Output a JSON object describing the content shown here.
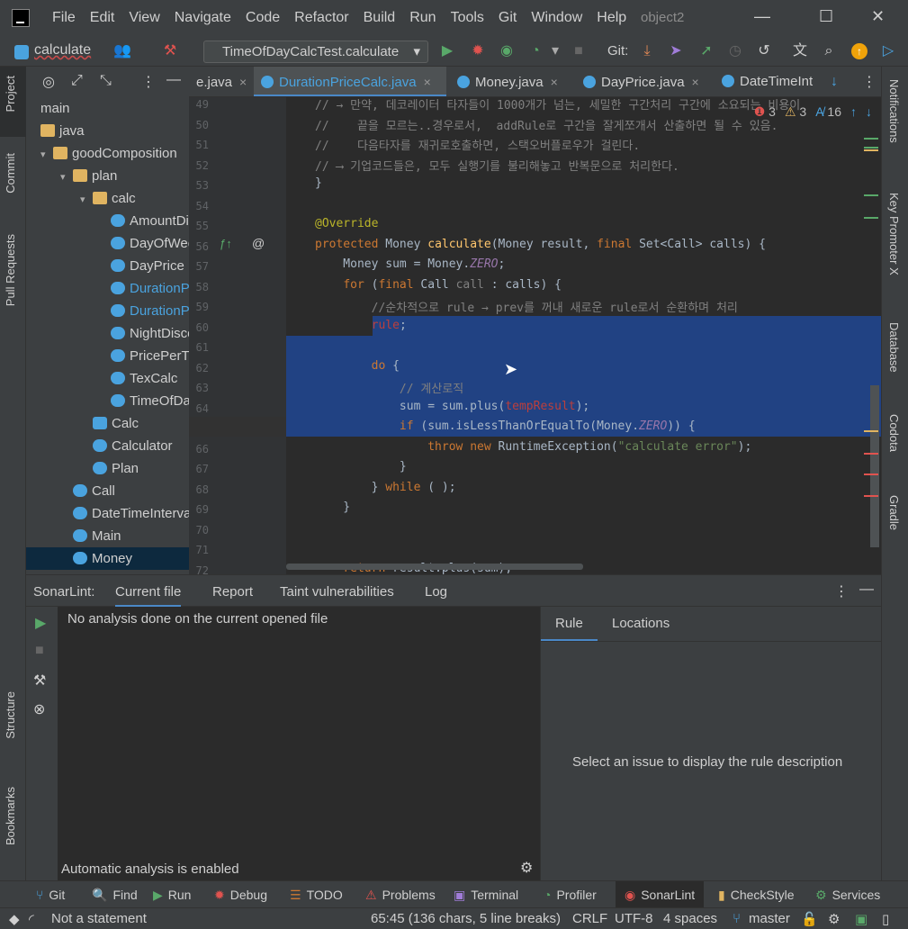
{
  "menubar": {
    "items": [
      "File",
      "Edit",
      "View",
      "Navigate",
      "Code",
      "Refactor",
      "Build",
      "Run",
      "Tools",
      "Git",
      "Window",
      "Help"
    ],
    "project_name": "object2"
  },
  "toolbar": {
    "breadcrumb": "calculate",
    "run_config": "TimeOfDayCalcTest.calculate",
    "git_label": "Git:"
  },
  "left_strip": {
    "project": "Project",
    "commit": "Commit",
    "pull_requests": "Pull Requests",
    "structure": "Structure",
    "bookmarks": "Bookmarks"
  },
  "right_strip": {
    "notifications": "Notifications",
    "key_promoter": "Key Promoter X",
    "database": "Database",
    "codota": "Codota",
    "gradle": "Gradle"
  },
  "project_tree": {
    "rows": [
      {
        "label": "main",
        "indent": 0,
        "icon": "none"
      },
      {
        "label": "java",
        "indent": 0,
        "icon": "folder"
      },
      {
        "label": "goodComposition",
        "indent": 1,
        "icon": "folder",
        "caret": "▾"
      },
      {
        "label": "plan",
        "indent": 2,
        "icon": "folder",
        "caret": "▾"
      },
      {
        "label": "calc",
        "indent": 3,
        "icon": "folder",
        "caret": "▾"
      },
      {
        "label": "AmountDis",
        "indent": 4,
        "icon": "cls"
      },
      {
        "label": "DayOfWee",
        "indent": 4,
        "icon": "cls"
      },
      {
        "label": "DayPrice",
        "indent": 4,
        "icon": "cls"
      },
      {
        "label": "DurationPri",
        "indent": 4,
        "icon": "cls",
        "modified": true
      },
      {
        "label": "DurationPri",
        "indent": 4,
        "icon": "cls",
        "modified": true
      },
      {
        "label": "NightDisco",
        "indent": 4,
        "icon": "cls"
      },
      {
        "label": "PricePerTim",
        "indent": 4,
        "icon": "cls"
      },
      {
        "label": "TexCalc",
        "indent": 4,
        "icon": "cls"
      },
      {
        "label": "TimeOfDay",
        "indent": 4,
        "icon": "cls"
      },
      {
        "label": "Calc",
        "indent": 3,
        "icon": "iface"
      },
      {
        "label": "Calculator",
        "indent": 3,
        "icon": "cls"
      },
      {
        "label": "Plan",
        "indent": 3,
        "icon": "cls"
      },
      {
        "label": "Call",
        "indent": 2,
        "icon": "cls"
      },
      {
        "label": "DateTimeInterval",
        "indent": 2,
        "icon": "cls"
      },
      {
        "label": "Main",
        "indent": 2,
        "icon": "cls"
      },
      {
        "label": "Money",
        "indent": 2,
        "icon": "cls",
        "selected": true
      }
    ]
  },
  "editor_tabs": [
    {
      "label": "e.java",
      "active": false
    },
    {
      "label": "DurationPriceCalc.java",
      "active": true
    },
    {
      "label": "Money.java",
      "active": false
    },
    {
      "label": "DayPrice.java",
      "active": false
    },
    {
      "label": "DateTimeInt",
      "active": false
    }
  ],
  "inspections": {
    "errors": "3",
    "warnings": "3",
    "typos": "16"
  },
  "editor": {
    "lines": [
      {
        "n": "49",
        "html": "<span class=\"cm\">// → 만약, 데코레이터 타자들이 1000개가 넘는, 세밀한 구간처리 구간에 소요되는 비용이</span>"
      },
      {
        "n": "50",
        "html": "<span class=\"cm\">//    끝을 모르는..경우로서,  addRule로 구간을 잘게쪼개서 산출하면 될 수 있음.</span>"
      },
      {
        "n": "51",
        "html": "<span class=\"cm\">//    다음타자를 재귀로호출하면, 스택오버플로우가 걸린다.</span>"
      },
      {
        "n": "52",
        "html": "<span class=\"cm\">// ⟶ 기업코드들은, 모두 실행기를 불리해놓고 반복문으로 처리한다.</span>"
      },
      {
        "n": "53",
        "html": "}"
      },
      {
        "n": "54",
        "html": ""
      },
      {
        "n": "55",
        "html": "<span class=\"an\">@Override</span>"
      },
      {
        "n": "56",
        "html": "<span class=\"kw\">protected</span> Money <span class=\"fn\">calculate</span>(Money result, <span class=\"kw\">final</span> Set&lt;Call&gt; calls) {"
      },
      {
        "n": "57",
        "html": "    Money sum = Money.<span class=\"it\">ZERO</span>;"
      },
      {
        "n": "58",
        "html": "    <span class=\"kw\">for</span> (<span class=\"kw\">final</span> Call <span class=\"cm\">call</span> : calls) {"
      },
      {
        "n": "59",
        "html": "        <span class=\"cm\">//순차적으로 rule → prev를 꺼내 새로운 rule로서 순환하며 처리</span>"
      },
      {
        "n": "60",
        "html": "        <span class=\"err\">rule</span>;"
      },
      {
        "n": "61",
        "html": ""
      },
      {
        "n": "62",
        "html": "        <span class=\"kw\">do</span> {"
      },
      {
        "n": "63",
        "html": "            <span class=\"cm\">// 계산로직</span>"
      },
      {
        "n": "64",
        "html": "            sum = sum.plus(<span class=\"err\">tempResult</span>);"
      },
      {
        "n": "65",
        "html": "            <span class=\"kw\">if</span> (sum.isLessThanOrEqualTo(Money.<span class=\"it\">ZERO</span>)) {"
      },
      {
        "n": "66",
        "html": "                <span class=\"kw\">throw new</span> RuntimeException(<span class=\"st\">\"calculate error\"</span>);"
      },
      {
        "n": "67",
        "html": "            }"
      },
      {
        "n": "68",
        "html": "        } <span class=\"kw\">while</span> ( );"
      },
      {
        "n": "69",
        "html": "    }"
      },
      {
        "n": "70",
        "html": ""
      },
      {
        "n": "71",
        "html": ""
      },
      {
        "n": "72",
        "html": "    <span class=\"kw\">return</span> result.plus(sum);"
      }
    ]
  },
  "sonar": {
    "label": "SonarLint:",
    "tabs": [
      "Current file",
      "Report",
      "Taint vulnerabilities",
      "Log"
    ],
    "message": "No analysis done on the current opened file",
    "auto_analysis": "Automatic analysis is enabled",
    "right_tabs": [
      "Rule",
      "Locations"
    ],
    "rule_hint": "Select an issue to display the rule description"
  },
  "toolstrip": [
    {
      "label": "Git",
      "icon": "git-icon"
    },
    {
      "label": "Find",
      "icon": "find-icon"
    },
    {
      "label": "Run",
      "icon": "run-icon"
    },
    {
      "label": "Debug",
      "icon": "debug-icon"
    },
    {
      "label": "TODO",
      "icon": "todo-icon"
    },
    {
      "label": "Problems",
      "icon": "problems-icon"
    },
    {
      "label": "Terminal",
      "icon": "terminal-icon"
    },
    {
      "label": "Profiler",
      "icon": "profiler-icon"
    },
    {
      "label": "SonarLint",
      "icon": "sonarlint-icon"
    },
    {
      "label": "CheckStyle",
      "icon": "checkstyle-icon"
    },
    {
      "label": "Services",
      "icon": "services-icon"
    }
  ],
  "statusbar": {
    "message": "Not a statement",
    "position": "65:45 (136 chars, 5 line breaks)",
    "line_sep": "CRLF",
    "encoding": "UTF-8",
    "indent": "4 spaces",
    "branch": "master"
  },
  "colors": {
    "accent": "#4a88c7",
    "selection": "#214283",
    "error": "#e0534f",
    "warning": "#e0b461"
  }
}
